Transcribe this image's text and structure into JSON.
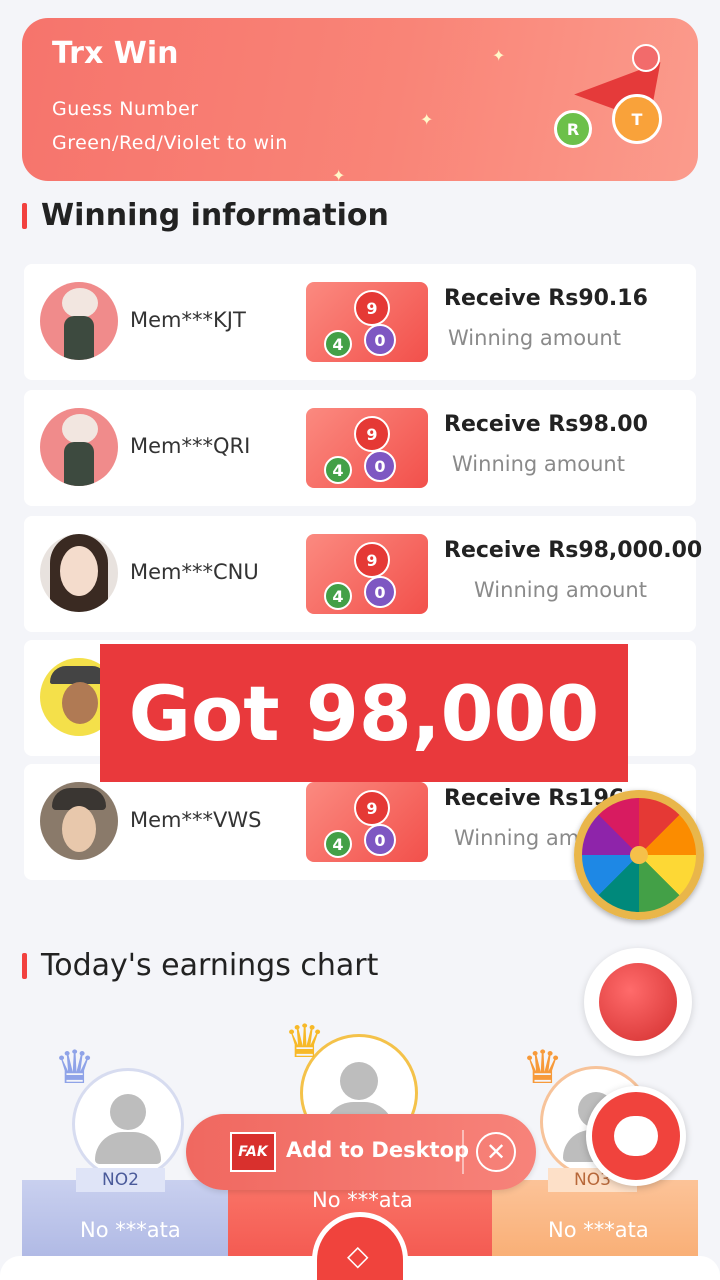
{
  "banner": {
    "title": "Trx Win",
    "line1": "Guess Number",
    "line2": "Green/Red/Violet to win",
    "ball_labels": [
      "R",
      "T"
    ]
  },
  "winning_section": {
    "title": "Winning information",
    "rows": [
      {
        "member": "Mem***KJT",
        "receive": "Receive Rs90.16",
        "label": "Winning amount",
        "thumb_numbers": [
          "9",
          "4",
          "0"
        ]
      },
      {
        "member": "Mem***QRI",
        "receive": "Receive Rs98.00",
        "label": "Winning amount",
        "thumb_numbers": [
          "9",
          "4",
          "0"
        ]
      },
      {
        "member": "Mem***CNU",
        "receive": "Receive Rs98,000.00",
        "label": "Winning amount",
        "thumb_numbers": [
          "9",
          "4",
          "0"
        ]
      },
      {
        "member": "",
        "receive": "",
        "label": "",
        "thumb_numbers": []
      },
      {
        "member": "Mem***VWS",
        "receive": "Receive Rs196.",
        "label": "Winning am",
        "thumb_numbers": [
          "9",
          "4",
          "0"
        ]
      }
    ]
  },
  "caption": "Got 98,000",
  "earnings_section": {
    "title": "Today's earnings chart",
    "podium": [
      {
        "rank": "NO2",
        "name": "No ***ata"
      },
      {
        "rank": "",
        "name": "No ***ata"
      },
      {
        "rank": "NO3",
        "name": "No ***ata"
      }
    ]
  },
  "add_to_desktop": {
    "logo": "FAK",
    "label": "Add to Desktop"
  },
  "colors": {
    "accent": "#f2413f",
    "banner": "#f6746c",
    "caption_bg": "#e9393c"
  }
}
